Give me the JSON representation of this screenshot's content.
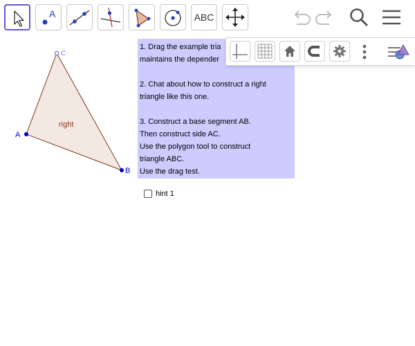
{
  "toolbar": {
    "tools": [
      {
        "name": "move-tool",
        "active": true
      },
      {
        "name": "point-tool",
        "label": "A"
      },
      {
        "name": "line-tool"
      },
      {
        "name": "perpendicular-line-tool"
      },
      {
        "name": "polygon-tool"
      },
      {
        "name": "circle-tool"
      },
      {
        "name": "text-tool",
        "label": "ABC"
      },
      {
        "name": "move-graphics-view-tool"
      }
    ]
  },
  "stylebar": {
    "buttons": [
      "axes-icon",
      "grid-icon",
      "home-icon",
      "snap-magnet-icon",
      "settings-gear-icon",
      "more-vertical-icon",
      "style-bar-toggle-icon"
    ]
  },
  "instructions": {
    "line1": "1. Drag the example tria",
    "line2": "maintains the depender",
    "line3": "2. Chat about how to construct a right",
    "line4": "triangle like this one.",
    "line5": "3. Construct a base segment AB.",
    "line6": "Then construct side AC.",
    "line7": "Use the polygon tool to construct",
    "line8": "triangle ABC.",
    "line9": "Use the drag test."
  },
  "hint": {
    "label": "hint 1",
    "checked": false
  },
  "geometry": {
    "points": [
      {
        "label": "A",
        "color": "#0000cc"
      },
      {
        "label": "B",
        "color": "#0000cc"
      },
      {
        "label": "C",
        "color": "#7777ee"
      }
    ],
    "polygon_label": "right",
    "polygon_fill": "#f4e8e2",
    "polygon_stroke": "#7a3a1e",
    "label_color": "#8b3a1e"
  },
  "colors": {
    "accent": "#6557d2",
    "text_box_bg": "#ccccff"
  }
}
